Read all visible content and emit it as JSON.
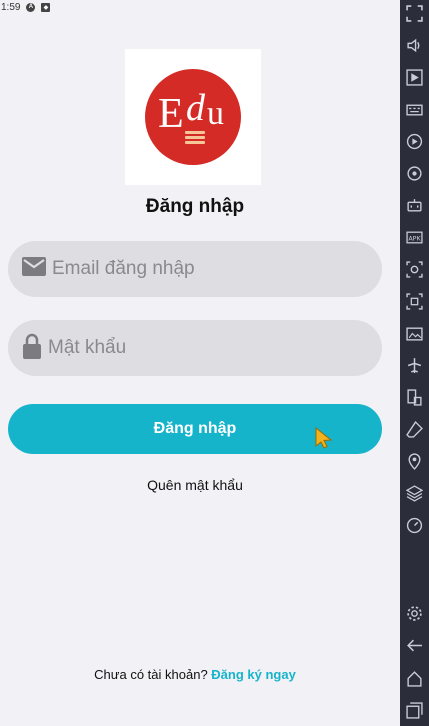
{
  "status_bar": {
    "time": "1:59",
    "icons": [
      "a-icon",
      "shield-icon"
    ]
  },
  "logo": {
    "text_E": "E",
    "text_d": "d",
    "text_u": "u",
    "bg_color": "#d42b26"
  },
  "title": "Đăng nhập",
  "email": {
    "placeholder": "Email đăng nhập",
    "value": ""
  },
  "password": {
    "placeholder": "Mật khẩu",
    "value": ""
  },
  "login_button": {
    "label": "Đăng nhập",
    "color": "#16b4cb"
  },
  "forgot_link": "Quên mật khẩu",
  "signup": {
    "question": "Chưa có tài khoản? ",
    "link": "Đăng ký ngay"
  },
  "toolbar": {
    "icons": [
      "fullscreen-icon",
      "volume-icon",
      "cursor-play-icon",
      "keyboard-icon",
      "record-icon",
      "sync-icon",
      "robot-icon",
      "apk-icon",
      "screenshot-icon",
      "resize-icon",
      "folder-icon",
      "airplane-icon",
      "shake-icon",
      "eraser-icon",
      "location-icon",
      "layers-icon",
      "speed-icon",
      "settings-icon",
      "back-icon",
      "home-icon",
      "recent-apps-icon"
    ]
  }
}
